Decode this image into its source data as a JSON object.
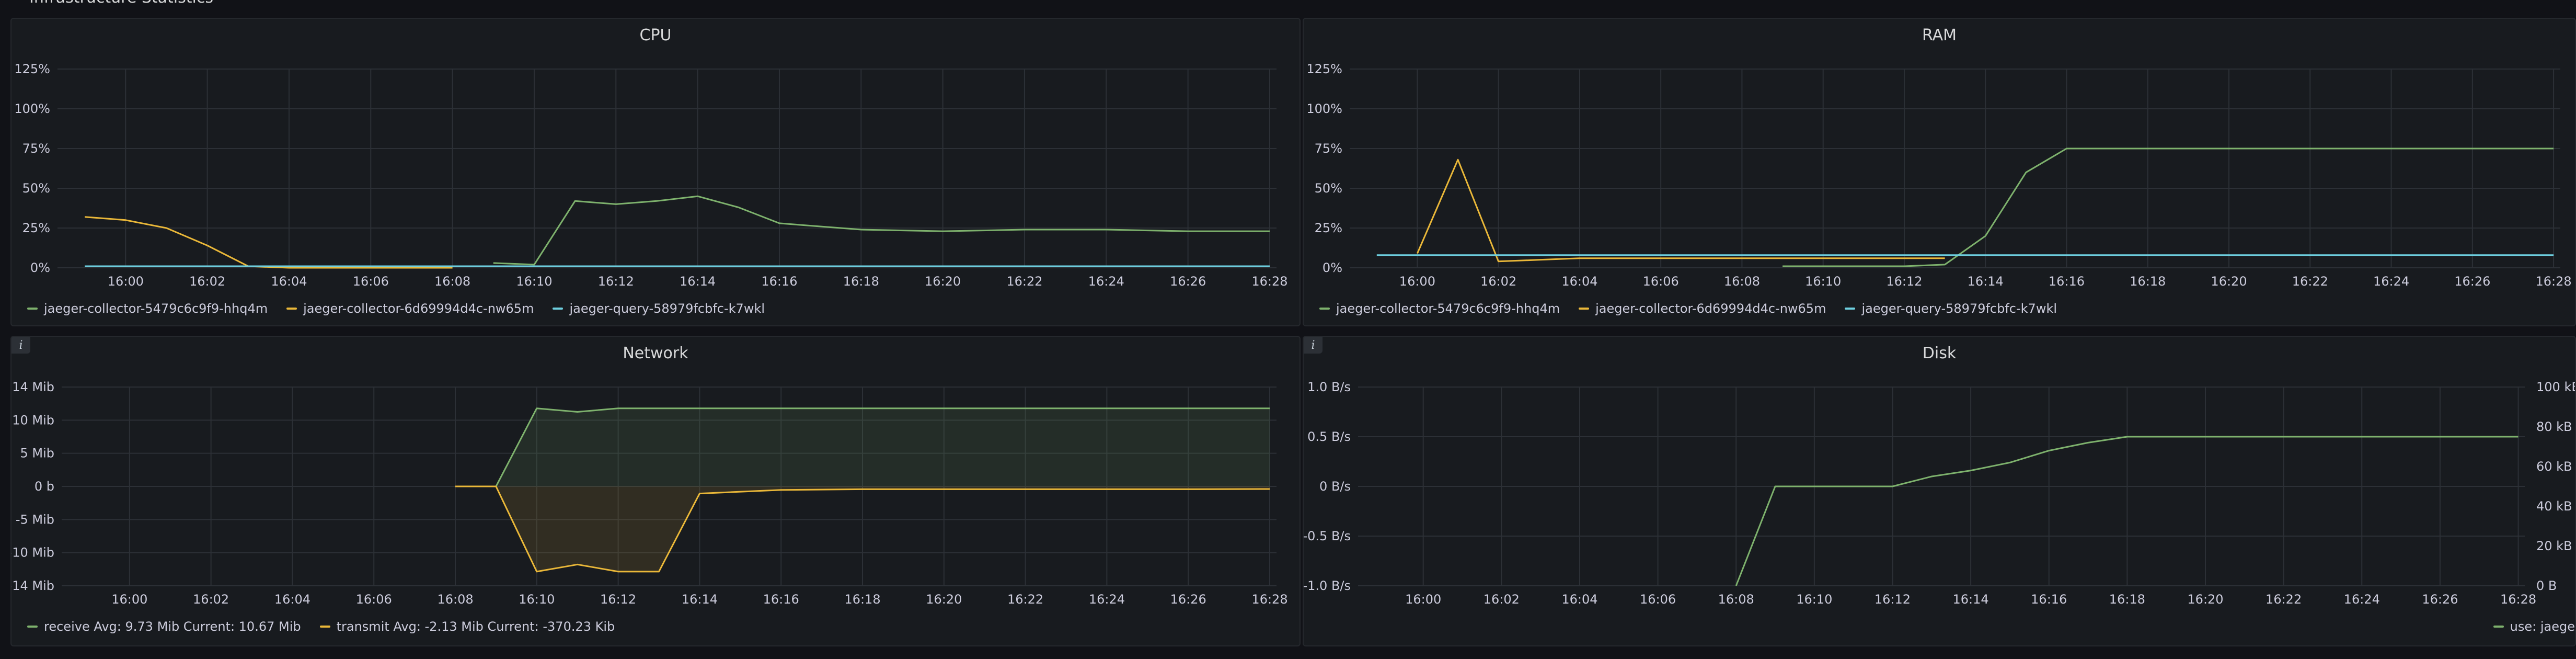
{
  "row_title": "Infrastructure Statistics",
  "colors": {
    "green": "#7eb26d",
    "yellow": "#eab839",
    "cyan": "#6ed0e0",
    "grid": "#2c3036",
    "axis_text": "#ccccdc"
  },
  "time_ticks": [
    "16:00",
    "16:02",
    "16:04",
    "16:06",
    "16:08",
    "16:10",
    "16:12",
    "16:14",
    "16:16",
    "16:18",
    "16:20",
    "16:22",
    "16:24",
    "16:26",
    "16:28"
  ],
  "panels": {
    "cpu": {
      "title": "CPU",
      "legend": [
        {
          "label": "jaeger-collector-5479c6c9f9-hhq4m",
          "color": "#7eb26d"
        },
        {
          "label": "jaeger-collector-6d69994d4c-nw65m",
          "color": "#eab839"
        },
        {
          "label": "jaeger-query-58979fcbfc-k7wkl",
          "color": "#6ed0e0"
        }
      ]
    },
    "ram": {
      "title": "RAM",
      "legend": [
        {
          "label": "jaeger-collector-5479c6c9f9-hhq4m",
          "color": "#7eb26d"
        },
        {
          "label": "jaeger-collector-6d69994d4c-nw65m",
          "color": "#eab839"
        },
        {
          "label": "jaeger-query-58979fcbfc-k7wkl",
          "color": "#6ed0e0"
        }
      ]
    },
    "network": {
      "title": "Network",
      "info": "i",
      "legend": [
        {
          "label": "receive  Avg: 9.73 Mib  Current: 10.67 Mib",
          "color": "#7eb26d"
        },
        {
          "label": "transmit  Avg: -2.13 Mib  Current: -370.23 Kib",
          "color": "#eab839"
        }
      ]
    },
    "disk": {
      "title": "Disk",
      "info": "i",
      "legend_right": {
        "label": "use: jaege",
        "color": "#7eb26d"
      }
    }
  },
  "chart_data": [
    {
      "type": "line",
      "title": "CPU",
      "x": [
        "15:59",
        "16:00",
        "16:01",
        "16:02",
        "16:03",
        "16:04",
        "16:06",
        "16:08",
        "16:09",
        "16:10",
        "16:11",
        "16:12",
        "16:13",
        "16:14",
        "16:15",
        "16:16",
        "16:18",
        "16:20",
        "16:22",
        "16:24",
        "16:26",
        "16:28"
      ],
      "y_ticks": [
        "0%",
        "25%",
        "50%",
        "75%",
        "100%",
        "125%"
      ],
      "ylim": [
        0,
        125
      ],
      "series": [
        {
          "name": "jaeger-collector-5479c6c9f9-hhq4m",
          "values": [
            null,
            null,
            null,
            null,
            null,
            null,
            null,
            null,
            3,
            2,
            42,
            40,
            42,
            45,
            38,
            28,
            24,
            23,
            24,
            24,
            23,
            23
          ]
        },
        {
          "name": "jaeger-collector-6d69994d4c-nw65m",
          "values": [
            32,
            30,
            25,
            14,
            1,
            0,
            0,
            0,
            null,
            null,
            null,
            null,
            null,
            null,
            null,
            null,
            null,
            null,
            null,
            null,
            null,
            null
          ]
        },
        {
          "name": "jaeger-query-58979fcbfc-k7wkl",
          "values": [
            1,
            1,
            1,
            1,
            1,
            1,
            1,
            1,
            1,
            1,
            1,
            1,
            1,
            1,
            1,
            1,
            1,
            1,
            1,
            1,
            1,
            1
          ]
        }
      ]
    },
    {
      "type": "line",
      "title": "RAM",
      "x": [
        "15:59",
        "16:00",
        "16:01",
        "16:02",
        "16:03",
        "16:04",
        "16:06",
        "16:08",
        "16:09",
        "16:10",
        "16:11",
        "16:12",
        "16:13",
        "16:14",
        "16:15",
        "16:16",
        "16:18",
        "16:20",
        "16:22",
        "16:24",
        "16:26",
        "16:28"
      ],
      "y_ticks": [
        "0%",
        "25%",
        "50%",
        "75%",
        "100%",
        "125%"
      ],
      "ylim": [
        0,
        125
      ],
      "series": [
        {
          "name": "jaeger-collector-5479c6c9f9-hhq4m",
          "values": [
            null,
            null,
            null,
            null,
            null,
            null,
            null,
            null,
            1,
            1,
            1,
            1,
            2,
            20,
            60,
            75,
            75,
            75,
            75,
            75,
            75,
            75
          ]
        },
        {
          "name": "jaeger-collector-6d69994d4c-nw65m",
          "values": [
            null,
            9,
            68,
            4,
            5,
            6,
            6,
            6,
            6,
            6,
            6,
            6,
            6,
            null,
            null,
            null,
            null,
            null,
            null,
            null,
            null,
            null
          ]
        },
        {
          "name": "jaeger-query-58979fcbfc-k7wkl",
          "values": [
            8,
            8,
            8,
            8,
            8,
            8,
            8,
            8,
            8,
            8,
            8,
            8,
            8,
            8,
            8,
            8,
            8,
            8,
            8,
            8,
            8,
            8
          ]
        }
      ]
    },
    {
      "type": "area",
      "title": "Network",
      "x": [
        "16:08",
        "16:09",
        "16:10",
        "16:11",
        "16:12",
        "16:13",
        "16:14",
        "16:16",
        "16:18",
        "16:20",
        "16:22",
        "16:24",
        "16:26",
        "16:28"
      ],
      "y_ticks": [
        "-14 Mib",
        "-10 Mib",
        "-5 Mib",
        "0 b",
        "5 Mib",
        "10 Mib",
        "14 Mib"
      ],
      "ylim": [
        -14,
        14
      ],
      "series": [
        {
          "name": "receive",
          "values": [
            0,
            0,
            11,
            10.5,
            11,
            11,
            11,
            11,
            11,
            11,
            11,
            11,
            11,
            11
          ]
        },
        {
          "name": "transmit",
          "values": [
            0,
            0,
            -12,
            -11,
            -12,
            -12,
            -1,
            -0.5,
            -0.4,
            -0.4,
            -0.4,
            -0.4,
            -0.4,
            -0.37
          ]
        }
      ]
    },
    {
      "type": "line",
      "title": "Disk",
      "x": [
        "16:08",
        "16:09",
        "16:12",
        "16:13",
        "16:14",
        "16:15",
        "16:16",
        "16:17",
        "16:18",
        "16:28"
      ],
      "y_ticks": [
        "-1.0 B/s",
        "-0.5 B/s",
        "0 B/s",
        "0.5 B/s",
        "1.0 B/s"
      ],
      "y2_ticks": [
        "0 B",
        "20 kB",
        "40 kB",
        "60 kB",
        "80 kB",
        "100 kB"
      ],
      "ylim": [
        -1,
        1
      ],
      "y2lim": [
        0,
        100
      ],
      "series": [
        {
          "name": "use: jaege",
          "axis": "right",
          "values": [
            0,
            50,
            50,
            55,
            58,
            62,
            68,
            72,
            75,
            75
          ]
        }
      ]
    }
  ]
}
